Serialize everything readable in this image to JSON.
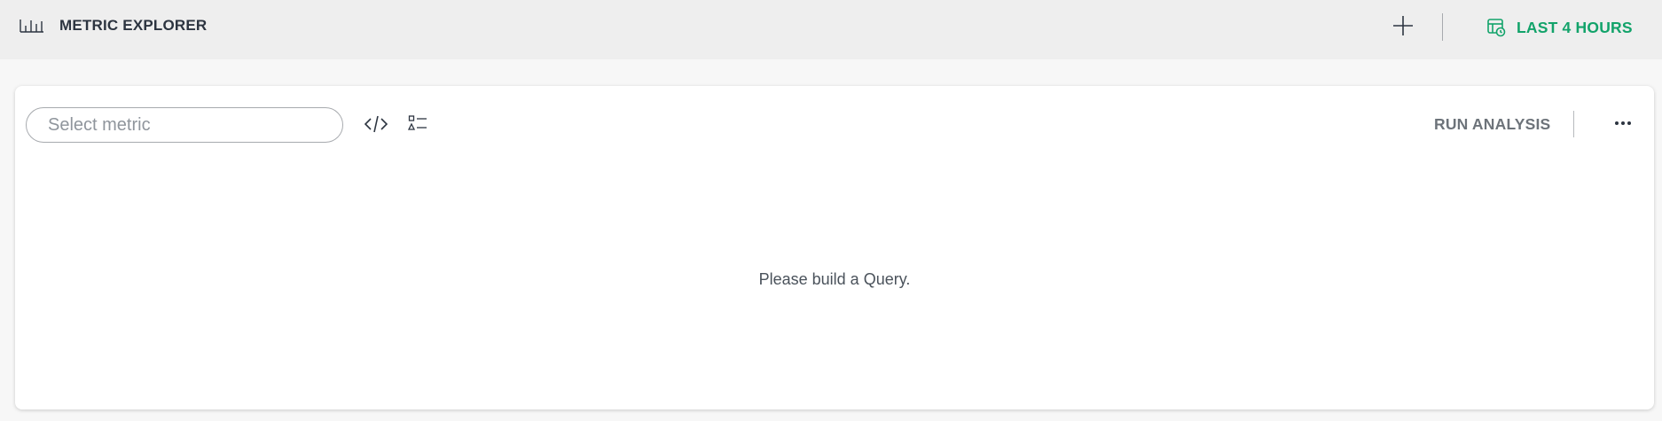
{
  "header": {
    "title": "METRIC EXPLORER",
    "timeframe_label": "LAST 4 HOURS",
    "app_icon": "bar-chart-icon",
    "add_icon": "plus-icon",
    "calendar_icon": "calendar-clock-icon"
  },
  "query_builder": {
    "metric_placeholder": "Select metric",
    "code_icon": "code-icon",
    "list_icon": "list-icon",
    "run_label": "RUN ANALYSIS",
    "more_icon": "more-horizontal-icon"
  },
  "main": {
    "empty_message": "Please build a Query."
  },
  "colors": {
    "accent": "#12a36a",
    "header_bg": "#eeeeee",
    "text": "#2c3440"
  }
}
